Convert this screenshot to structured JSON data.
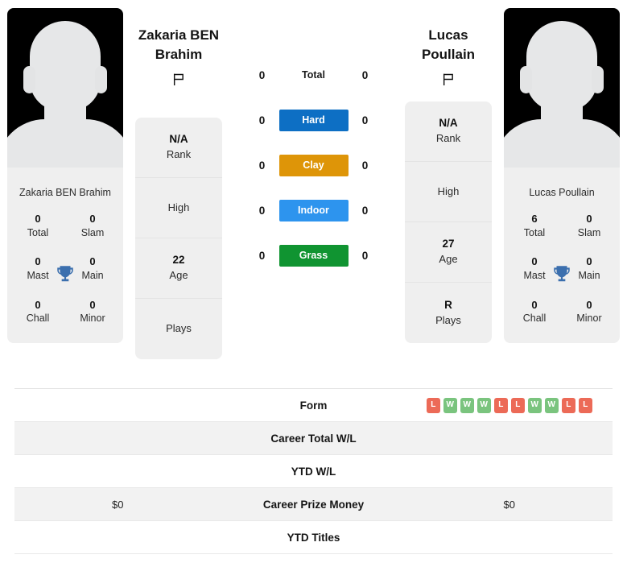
{
  "players": {
    "left": {
      "name_line1": "Zakaria BEN",
      "name_line2": "Brahim",
      "full_name": "Zakaria BEN Brahim",
      "flag_icon": "flag-outline-icon",
      "avatar_icon": "player-silhouette-avatar",
      "info": [
        {
          "value": "N/A",
          "label": "Rank"
        },
        {
          "value": "",
          "label": "High"
        },
        {
          "value": "22",
          "label": "Age"
        },
        {
          "value": "",
          "label": "Plays"
        }
      ],
      "titles": [
        {
          "value": "0",
          "label": "Total"
        },
        {
          "value": "0",
          "label": "Slam"
        },
        {
          "value": "0",
          "label": "Mast"
        },
        {
          "value": "0",
          "label": "Main"
        },
        {
          "value": "0",
          "label": "Chall"
        },
        {
          "value": "0",
          "label": "Minor"
        }
      ],
      "trophy_icon": "trophy-icon"
    },
    "right": {
      "name_line1": "Lucas",
      "name_line2": "Poullain",
      "full_name": "Lucas Poullain",
      "flag_icon": "flag-outline-icon",
      "avatar_icon": "player-silhouette-avatar",
      "info": [
        {
          "value": "N/A",
          "label": "Rank"
        },
        {
          "value": "",
          "label": "High"
        },
        {
          "value": "27",
          "label": "Age"
        },
        {
          "value": "R",
          "label": "Plays"
        }
      ],
      "titles": [
        {
          "value": "6",
          "label": "Total"
        },
        {
          "value": "0",
          "label": "Slam"
        },
        {
          "value": "0",
          "label": "Mast"
        },
        {
          "value": "0",
          "label": "Main"
        },
        {
          "value": "0",
          "label": "Chall"
        },
        {
          "value": "0",
          "label": "Minor"
        }
      ],
      "trophy_icon": "trophy-icon"
    }
  },
  "surfaces": [
    {
      "label": "Total",
      "left": "0",
      "right": "0",
      "style": "plain",
      "color": ""
    },
    {
      "label": "Hard",
      "left": "0",
      "right": "0",
      "style": "pill",
      "color": "#0d6fc4"
    },
    {
      "label": "Clay",
      "left": "0",
      "right": "0",
      "style": "pill",
      "color": "#de9508"
    },
    {
      "label": "Indoor",
      "left": "0",
      "right": "0",
      "style": "pill",
      "color": "#2d94ee"
    },
    {
      "label": "Grass",
      "left": "0",
      "right": "0",
      "style": "pill",
      "color": "#109431"
    }
  ],
  "table": {
    "rows": [
      {
        "label": "Form",
        "left": "",
        "right": "",
        "right_form": [
          "L",
          "W",
          "W",
          "W",
          "L",
          "L",
          "W",
          "W",
          "L",
          "L"
        ],
        "alt": false
      },
      {
        "label": "Career Total W/L",
        "left": "",
        "right": "",
        "alt": true
      },
      {
        "label": "YTD W/L",
        "left": "",
        "right": "",
        "alt": false
      },
      {
        "label": "Career Prize Money",
        "left": "$0",
        "right": "$0",
        "alt": true
      },
      {
        "label": "YTD Titles",
        "left": "",
        "right": "",
        "alt": false
      }
    ]
  },
  "colors": {
    "card_bg": "#efefef",
    "row_alt_bg": "#f2f2f2",
    "win_badge": "#7ac47e",
    "loss_badge": "#ec6a57",
    "trophy": "#3b6fae"
  }
}
